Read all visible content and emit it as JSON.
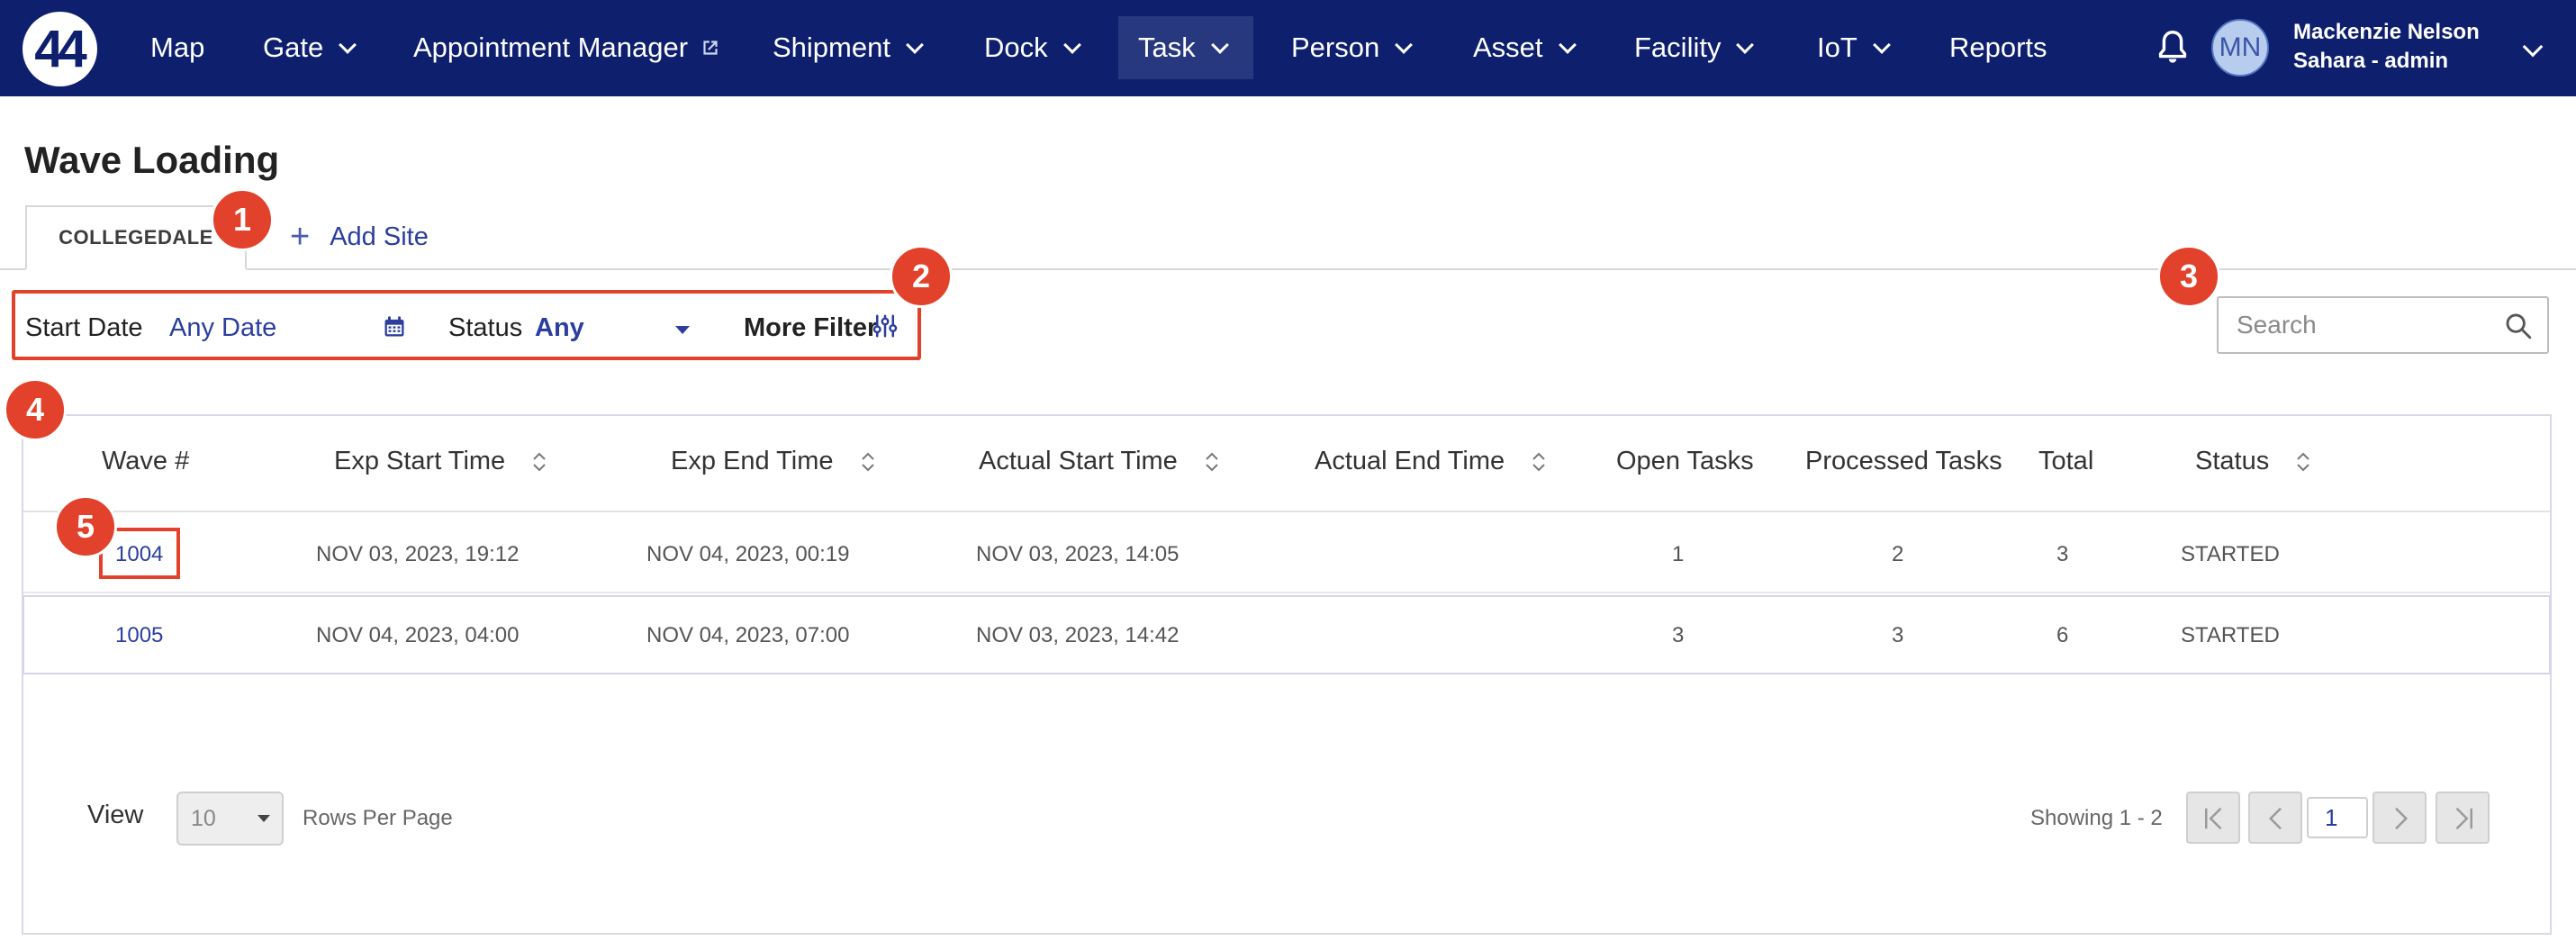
{
  "nav": {
    "logo_text": "44",
    "items": [
      {
        "label": "Map"
      },
      {
        "label": "Gate"
      },
      {
        "label": "Appointment Manager"
      },
      {
        "label": "Shipment"
      },
      {
        "label": "Dock"
      },
      {
        "label": "Task"
      },
      {
        "label": "Person"
      },
      {
        "label": "Asset"
      },
      {
        "label": "Facility"
      },
      {
        "label": "IoT"
      },
      {
        "label": "Reports"
      }
    ],
    "active_item": "Task",
    "user": {
      "initials": "MN",
      "name": "Mackenzie Nelson",
      "role": "Sahara - admin"
    }
  },
  "page": {
    "title": "Wave Loading",
    "site_tab": "COLLEGEDALE",
    "add_site": "Add Site"
  },
  "filters": {
    "start_date_label": "Start Date",
    "start_date_value": "Any Date",
    "status_label": "Status",
    "status_value": "Any",
    "more_filter": "More Filter"
  },
  "search": {
    "placeholder": "Search"
  },
  "table": {
    "headers": [
      "Wave #",
      "Exp Start Time",
      "Exp End Time",
      "Actual Start Time",
      "Actual End Time",
      "Open Tasks",
      "Processed Tasks",
      "Total",
      "Status"
    ],
    "rows": [
      {
        "wave": "1004",
        "exp_start": "NOV 03, 2023, 19:12",
        "exp_end": "NOV 04, 2023, 00:19",
        "actual_start": "NOV 03, 2023, 14:05",
        "actual_end": "",
        "open": "1",
        "processed": "2",
        "total": "3",
        "status": "STARTED"
      },
      {
        "wave": "1005",
        "exp_start": "NOV 04, 2023, 04:00",
        "exp_end": "NOV 04, 2023, 07:00",
        "actual_start": "NOV 03, 2023, 14:42",
        "actual_end": "",
        "open": "3",
        "processed": "3",
        "total": "6",
        "status": "STARTED"
      }
    ]
  },
  "pagination": {
    "view_label": "View",
    "rows_per_page_value": "10",
    "rows_per_page_label": "Rows Per Page",
    "showing": "Showing 1 - 2",
    "current_page": "1"
  },
  "markers": [
    "1",
    "2",
    "3",
    "4",
    "5"
  ],
  "colors": {
    "nav_bg": "#0e1f6e",
    "accent": "#2c3e9e",
    "marker": "#e2412b"
  }
}
